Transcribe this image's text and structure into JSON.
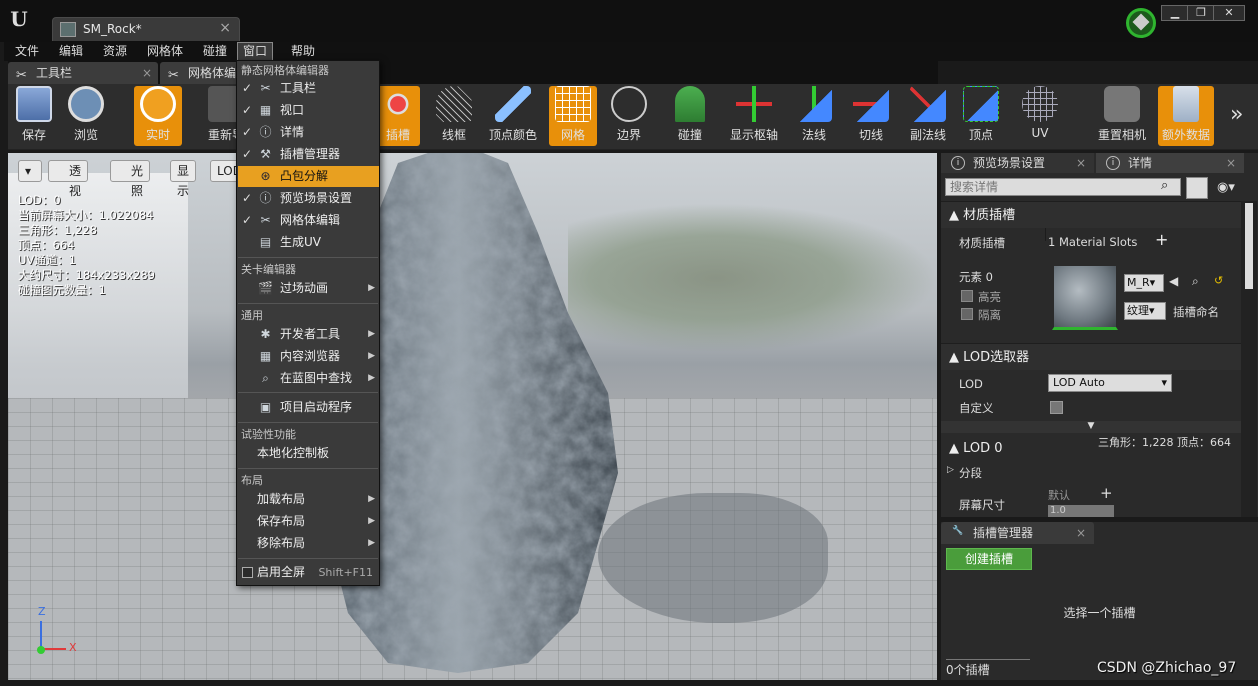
{
  "titlebar": {
    "logo": "U",
    "doc_tab": "SM_Rock*",
    "doc_close": "×",
    "win_buttons": [
      "▁",
      "❐",
      "✕"
    ],
    "colors": {
      "badge": "#2fb52f"
    }
  },
  "menubar": {
    "items": [
      "文件",
      "编辑",
      "资源",
      "网格体",
      "碰撞",
      "窗口",
      "帮助"
    ],
    "open": "窗口"
  },
  "panel_tabs": [
    {
      "label": "工具栏",
      "close": "×"
    },
    {
      "label": "网格体编",
      "close": ""
    }
  ],
  "toolbar": {
    "items": [
      {
        "label": "保存",
        "icon": "save-icon"
      },
      {
        "label": "浏览",
        "icon": "browse-icon"
      },
      {
        "label": "实时",
        "icon": "stopwatch-icon",
        "active": true
      },
      {
        "label": "重新导",
        "icon": "reimport-icon"
      },
      {
        "label": "插槽",
        "icon": "socket-icon",
        "active": true
      },
      {
        "label": "线框",
        "icon": "wireframe-icon"
      },
      {
        "label": "顶点颜色",
        "icon": "vertex-color-icon"
      },
      {
        "label": "网格",
        "icon": "grid-icon",
        "active": true
      },
      {
        "label": "边界",
        "icon": "bounds-icon"
      },
      {
        "label": "碰撞",
        "icon": "collision-icon"
      },
      {
        "label": "显示枢轴",
        "icon": "pivot-icon"
      },
      {
        "label": "法线",
        "icon": "normals-icon"
      },
      {
        "label": "切线",
        "icon": "tangents-icon"
      },
      {
        "label": "副法线",
        "icon": "binormals-icon"
      },
      {
        "label": "顶点",
        "icon": "vertices-icon"
      },
      {
        "label": "UV",
        "icon": "uv-icon"
      },
      {
        "label": "重置相机",
        "icon": "reset-camera-icon"
      },
      {
        "label": "额外数据",
        "icon": "extra-data-icon",
        "active": true
      }
    ],
    "more": "»",
    "colors": {
      "active": "#e8900a"
    }
  },
  "viewport": {
    "controls": [
      "▾",
      "透视",
      "光照",
      "显示",
      "LOD自"
    ],
    "stats": [
      "LOD：0",
      "当前屏幕大小：1.022084",
      "三角形：1,228",
      "顶点：664",
      "UV通道：1",
      "大约尺寸：184x233x289",
      "碰撞图元数量：1"
    ],
    "axis_x": "X",
    "axis_z": "Z"
  },
  "window_menu": {
    "sections": [
      {
        "header": "静态网格体编辑器",
        "items": [
          {
            "label": "工具栏",
            "checked": true,
            "icon": "toolbar-icon"
          },
          {
            "label": "视口",
            "checked": true,
            "icon": "viewport-icon"
          },
          {
            "label": "详情",
            "checked": true,
            "icon": "details-icon"
          },
          {
            "label": "插槽管理器",
            "checked": true,
            "icon": "socket-manager-icon"
          },
          {
            "label": "凸包分解",
            "checked": false,
            "icon": "convex-decomposition-icon",
            "selected": true
          },
          {
            "label": "预览场景设置",
            "checked": true,
            "icon": "preview-scene-icon"
          },
          {
            "label": "网格体编辑",
            "checked": true,
            "icon": "mesh-edit-icon"
          },
          {
            "label": "生成UV",
            "checked": false,
            "icon": "generate-uv-icon"
          }
        ]
      },
      {
        "header": "关卡编辑器",
        "items": [
          {
            "label": "过场动画",
            "icon": "cinematics-icon",
            "submenu": true
          }
        ]
      },
      {
        "header": "通用",
        "items": [
          {
            "label": "开发者工具",
            "icon": "developer-tools-icon",
            "submenu": true
          },
          {
            "label": "内容浏览器",
            "icon": "content-browser-icon",
            "submenu": true
          },
          {
            "label": "在蓝图中查找",
            "icon": "find-in-blueprints-icon",
            "submenu": true
          },
          {
            "label": "项目启动程序",
            "icon": "project-launcher-icon"
          }
        ]
      },
      {
        "header": "试验性功能",
        "items": [
          {
            "label": "本地化控制板"
          }
        ]
      },
      {
        "header": "布局",
        "items": [
          {
            "label": "加载布局",
            "submenu": true
          },
          {
            "label": "保存布局",
            "submenu": true
          },
          {
            "label": "移除布局",
            "submenu": true
          }
        ]
      }
    ],
    "fullscreen": {
      "label": "启用全屏",
      "shortcut": "Shift+F11"
    },
    "check_mark": "✓",
    "submenu_arrow": "▶",
    "colors": {
      "selected": "#e8a020"
    }
  },
  "details_panel": {
    "tabs": [
      {
        "label": "预览场景设置",
        "close": "×"
      },
      {
        "label": "详情",
        "close": "×"
      }
    ],
    "search_placeholder": "搜索详情",
    "material_slots": {
      "header": "材质插槽",
      "label": "材质插槽",
      "count": "1 Material Slots",
      "add": "+",
      "element": "元素 0",
      "highlight": "高亮",
      "isolate": "隔离",
      "material": "M_R",
      "texture": "纹理",
      "slot_name": "插槽命名"
    },
    "lod_picker": {
      "header": "LOD选取器",
      "lod_label": "LOD",
      "lod_value": "LOD Auto",
      "custom_label": "自定义"
    },
    "stats_line": "三角形：1,228    顶点：664",
    "lod0": {
      "header": "LOD 0",
      "section": "分段",
      "screen_size": "屏幕尺寸",
      "default": "默认",
      "value": "1.0"
    }
  },
  "socket_manager": {
    "tab": "插槽管理器",
    "close": "×",
    "create": "创建插槽",
    "empty": "选择一个插槽",
    "count": "0个插槽",
    "colors": {
      "create": "#4a9d3b"
    }
  },
  "watermark": "CSDN @Zhichao_97"
}
